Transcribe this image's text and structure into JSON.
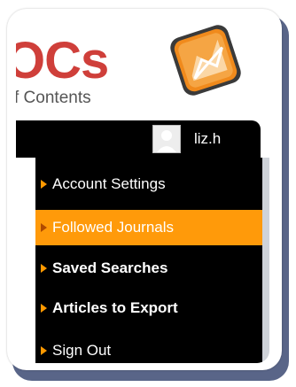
{
  "logo": {
    "title": "OCs",
    "subtitle": "f Contents"
  },
  "header": {
    "username": "liz.h"
  },
  "menu": {
    "items": [
      {
        "label": "Account Settings"
      },
      {
        "label": "Followed Journals"
      },
      {
        "label": "Saved Searches"
      },
      {
        "label": "Articles to Export"
      },
      {
        "label": "Sign Out"
      }
    ]
  },
  "colors": {
    "accent": "#ff9a0a",
    "brand_red": "#cf3f3a",
    "menu_bg": "#000000",
    "card_shadow": "#3c4a73"
  }
}
